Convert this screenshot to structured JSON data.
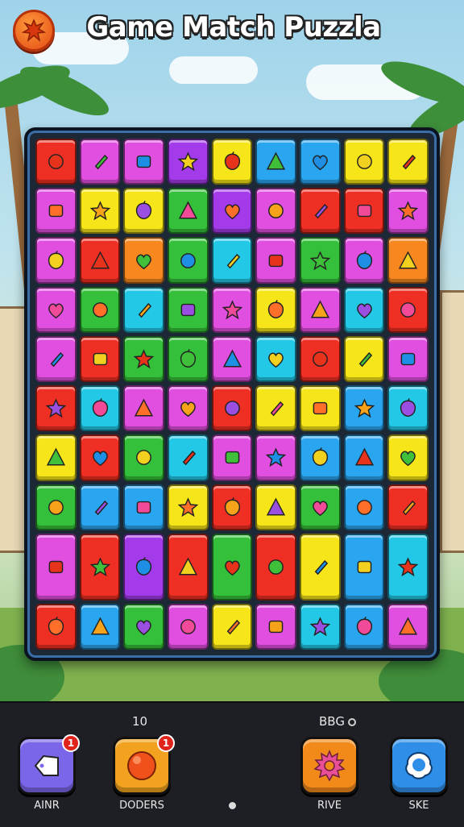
{
  "header": {
    "title": "Game Match Puzzla",
    "menu_icon": "splat-icon"
  },
  "board": {
    "rows": 10,
    "cols": 9,
    "colors": {
      "R": "#ef2f23",
      "M": "#e14fe0",
      "P": "#a33bea",
      "Y": "#f6e619",
      "B": "#2aa6f0",
      "G": "#34c03a",
      "O": "#f7881f",
      "C": "#22c8e6"
    },
    "tiles": [
      [
        "R",
        "M",
        "M",
        "P",
        "Y",
        "B",
        "B",
        "Y",
        "Y"
      ],
      [
        "M",
        "Y",
        "Y",
        "G",
        "P",
        "M",
        "R",
        "R",
        "M"
      ],
      [
        "M",
        "R",
        "O",
        "G",
        "C",
        "M",
        "G",
        "M",
        "O"
      ],
      [
        "M",
        "G",
        "C",
        "G",
        "M",
        "Y",
        "M",
        "C",
        "R"
      ],
      [
        "M",
        "R",
        "G",
        "G",
        "M",
        "C",
        "R",
        "Y",
        "M"
      ],
      [
        "R",
        "C",
        "M",
        "M",
        "R",
        "Y",
        "Y",
        "B",
        "C"
      ],
      [
        "Y",
        "R",
        "G",
        "C",
        "M",
        "M",
        "B",
        "B",
        "Y"
      ],
      [
        "G",
        "B",
        "B",
        "Y",
        "R",
        "Y",
        "G",
        "B",
        "R"
      ],
      [
        "M",
        "R",
        "P",
        "R",
        "G",
        "R",
        "Y",
        "B",
        "C"
      ],
      [
        "R",
        "B",
        "G",
        "M",
        "Y",
        "M",
        "C",
        "B",
        "M"
      ]
    ],
    "tall_row_index": 8
  },
  "controls": {
    "counter_left": "10",
    "counter_right": "BBG",
    "buttons": [
      {
        "label": "AINR",
        "color": "#7a66e8",
        "icon": "tag-icon",
        "badge": "1"
      },
      {
        "label": "DODERS",
        "color": "#f2a21e",
        "icon": "orb-icon",
        "badge": "1"
      },
      {
        "label": "RIVE",
        "color": "#f28a1a",
        "icon": "gear-icon",
        "badge": ""
      },
      {
        "label": "SKE",
        "color": "#2f8fe8",
        "icon": "bubble-icon",
        "badge": ""
      }
    ]
  }
}
